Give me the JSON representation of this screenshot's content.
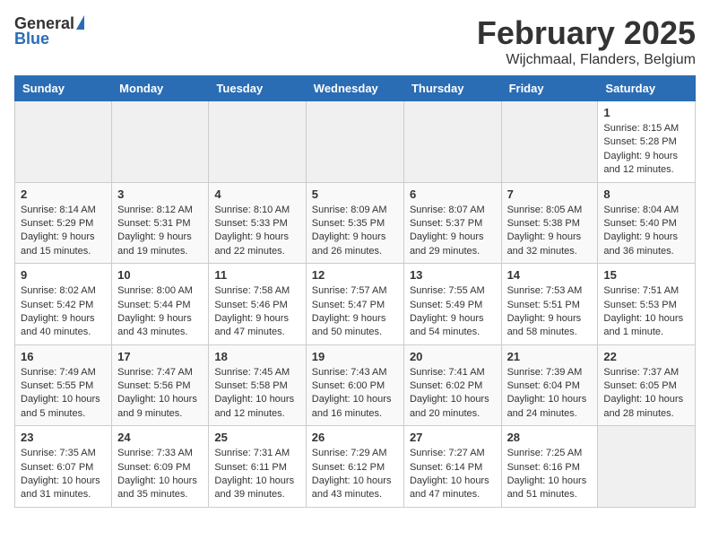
{
  "logo": {
    "general": "General",
    "blue": "Blue"
  },
  "header": {
    "month": "February 2025",
    "location": "Wijchmaal, Flanders, Belgium"
  },
  "weekdays": [
    "Sunday",
    "Monday",
    "Tuesday",
    "Wednesday",
    "Thursday",
    "Friday",
    "Saturday"
  ],
  "weeks": [
    [
      {
        "day": "",
        "info": ""
      },
      {
        "day": "",
        "info": ""
      },
      {
        "day": "",
        "info": ""
      },
      {
        "day": "",
        "info": ""
      },
      {
        "day": "",
        "info": ""
      },
      {
        "day": "",
        "info": ""
      },
      {
        "day": "1",
        "info": "Sunrise: 8:15 AM\nSunset: 5:28 PM\nDaylight: 9 hours and 12 minutes."
      }
    ],
    [
      {
        "day": "2",
        "info": "Sunrise: 8:14 AM\nSunset: 5:29 PM\nDaylight: 9 hours and 15 minutes."
      },
      {
        "day": "3",
        "info": "Sunrise: 8:12 AM\nSunset: 5:31 PM\nDaylight: 9 hours and 19 minutes."
      },
      {
        "day": "4",
        "info": "Sunrise: 8:10 AM\nSunset: 5:33 PM\nDaylight: 9 hours and 22 minutes."
      },
      {
        "day": "5",
        "info": "Sunrise: 8:09 AM\nSunset: 5:35 PM\nDaylight: 9 hours and 26 minutes."
      },
      {
        "day": "6",
        "info": "Sunrise: 8:07 AM\nSunset: 5:37 PM\nDaylight: 9 hours and 29 minutes."
      },
      {
        "day": "7",
        "info": "Sunrise: 8:05 AM\nSunset: 5:38 PM\nDaylight: 9 hours and 32 minutes."
      },
      {
        "day": "8",
        "info": "Sunrise: 8:04 AM\nSunset: 5:40 PM\nDaylight: 9 hours and 36 minutes."
      }
    ],
    [
      {
        "day": "9",
        "info": "Sunrise: 8:02 AM\nSunset: 5:42 PM\nDaylight: 9 hours and 40 minutes."
      },
      {
        "day": "10",
        "info": "Sunrise: 8:00 AM\nSunset: 5:44 PM\nDaylight: 9 hours and 43 minutes."
      },
      {
        "day": "11",
        "info": "Sunrise: 7:58 AM\nSunset: 5:46 PM\nDaylight: 9 hours and 47 minutes."
      },
      {
        "day": "12",
        "info": "Sunrise: 7:57 AM\nSunset: 5:47 PM\nDaylight: 9 hours and 50 minutes."
      },
      {
        "day": "13",
        "info": "Sunrise: 7:55 AM\nSunset: 5:49 PM\nDaylight: 9 hours and 54 minutes."
      },
      {
        "day": "14",
        "info": "Sunrise: 7:53 AM\nSunset: 5:51 PM\nDaylight: 9 hours and 58 minutes."
      },
      {
        "day": "15",
        "info": "Sunrise: 7:51 AM\nSunset: 5:53 PM\nDaylight: 10 hours and 1 minute."
      }
    ],
    [
      {
        "day": "16",
        "info": "Sunrise: 7:49 AM\nSunset: 5:55 PM\nDaylight: 10 hours and 5 minutes."
      },
      {
        "day": "17",
        "info": "Sunrise: 7:47 AM\nSunset: 5:56 PM\nDaylight: 10 hours and 9 minutes."
      },
      {
        "day": "18",
        "info": "Sunrise: 7:45 AM\nSunset: 5:58 PM\nDaylight: 10 hours and 12 minutes."
      },
      {
        "day": "19",
        "info": "Sunrise: 7:43 AM\nSunset: 6:00 PM\nDaylight: 10 hours and 16 minutes."
      },
      {
        "day": "20",
        "info": "Sunrise: 7:41 AM\nSunset: 6:02 PM\nDaylight: 10 hours and 20 minutes."
      },
      {
        "day": "21",
        "info": "Sunrise: 7:39 AM\nSunset: 6:04 PM\nDaylight: 10 hours and 24 minutes."
      },
      {
        "day": "22",
        "info": "Sunrise: 7:37 AM\nSunset: 6:05 PM\nDaylight: 10 hours and 28 minutes."
      }
    ],
    [
      {
        "day": "23",
        "info": "Sunrise: 7:35 AM\nSunset: 6:07 PM\nDaylight: 10 hours and 31 minutes."
      },
      {
        "day": "24",
        "info": "Sunrise: 7:33 AM\nSunset: 6:09 PM\nDaylight: 10 hours and 35 minutes."
      },
      {
        "day": "25",
        "info": "Sunrise: 7:31 AM\nSunset: 6:11 PM\nDaylight: 10 hours and 39 minutes."
      },
      {
        "day": "26",
        "info": "Sunrise: 7:29 AM\nSunset: 6:12 PM\nDaylight: 10 hours and 43 minutes."
      },
      {
        "day": "27",
        "info": "Sunrise: 7:27 AM\nSunset: 6:14 PM\nDaylight: 10 hours and 47 minutes."
      },
      {
        "day": "28",
        "info": "Sunrise: 7:25 AM\nSunset: 6:16 PM\nDaylight: 10 hours and 51 minutes."
      },
      {
        "day": "",
        "info": ""
      }
    ]
  ]
}
